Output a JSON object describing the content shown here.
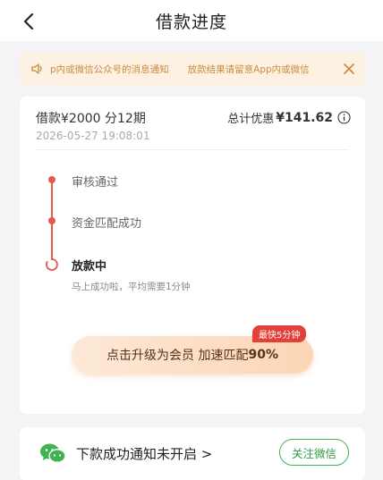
{
  "header": {
    "title": "借款进度",
    "back_icon": "chevron-left-icon"
  },
  "notice": {
    "icon": "speaker-icon",
    "text": "p内或微信公众号的消息通知　　放款结果请留意App内或微信",
    "close_icon": "close-icon"
  },
  "loan": {
    "amount_label": "借款¥2000",
    "term": "分12期",
    "date": "2026-05-27 19:08:01",
    "discount_label": "总计优惠",
    "discount_amount": "¥141.62"
  },
  "timeline": {
    "steps": [
      {
        "label": "审核通过",
        "status": "done"
      },
      {
        "label": "资金匹配成功",
        "status": "done"
      },
      {
        "label": "放款中",
        "status": "active",
        "sub": "马上成功啦，平均需要1分钟"
      }
    ]
  },
  "cta": {
    "text": "点击升级为会员 加速匹配",
    "highlight": "90%",
    "badge": "最快5分钟"
  },
  "bottom": {
    "text": "下款成功通知未开启 >",
    "button": "关注微信",
    "icon": "wechat-icon"
  },
  "colors": {
    "accent": "#e55a4e",
    "notice_bg": "#fdf1e3",
    "notice_text": "#c98c3c",
    "wechat_green": "#43b05a"
  }
}
